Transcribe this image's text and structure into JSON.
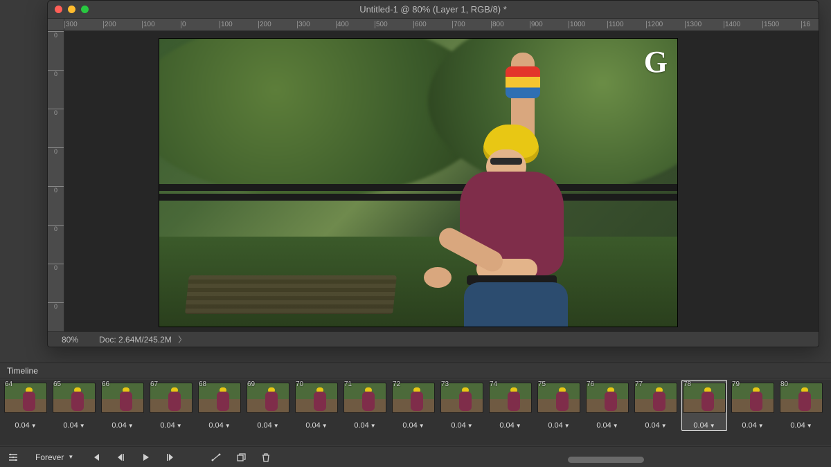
{
  "window": {
    "title": "Untitled-1 @ 80% (Layer 1, RGB/8) *",
    "traffic": {
      "close": "#ff5f57",
      "minimize": "#febc2e",
      "zoom": "#28c840"
    }
  },
  "ruler": {
    "h": [
      "300",
      "200",
      "100",
      "0",
      "100",
      "200",
      "300",
      "400",
      "500",
      "600",
      "700",
      "800",
      "900",
      "1000",
      "1100",
      "1200",
      "1300",
      "1400",
      "1500",
      "16"
    ],
    "v": [
      "0",
      "0",
      "0",
      "0",
      "0",
      "0",
      "0",
      "0"
    ]
  },
  "canvas": {
    "watermark": "G"
  },
  "status": {
    "zoom": "80%",
    "doc_label": "Doc: 2.64M/245.2M",
    "chevron": "〉"
  },
  "timeline": {
    "title": "Timeline",
    "loop_label": "Forever",
    "selected_index": 14,
    "frames": [
      {
        "n": "64",
        "d": "0.04"
      },
      {
        "n": "65",
        "d": "0.04"
      },
      {
        "n": "66",
        "d": "0.04"
      },
      {
        "n": "67",
        "d": "0.04"
      },
      {
        "n": "68",
        "d": "0.04"
      },
      {
        "n": "69",
        "d": "0.04"
      },
      {
        "n": "70",
        "d": "0.04"
      },
      {
        "n": "71",
        "d": "0.04"
      },
      {
        "n": "72",
        "d": "0.04"
      },
      {
        "n": "73",
        "d": "0.04"
      },
      {
        "n": "74",
        "d": "0.04"
      },
      {
        "n": "75",
        "d": "0.04"
      },
      {
        "n": "76",
        "d": "0.04"
      },
      {
        "n": "77",
        "d": "0.04"
      },
      {
        "n": "78",
        "d": "0.04"
      },
      {
        "n": "79",
        "d": "0.04"
      },
      {
        "n": "80",
        "d": "0.04"
      }
    ],
    "icons": {
      "options": "options-icon",
      "first": "first-frame-icon",
      "prev": "prev-frame-icon",
      "play": "play-icon",
      "next": "next-frame-icon",
      "tween": "tween-icon",
      "duplicate": "duplicate-frame-icon",
      "delete": "trash-icon"
    }
  }
}
